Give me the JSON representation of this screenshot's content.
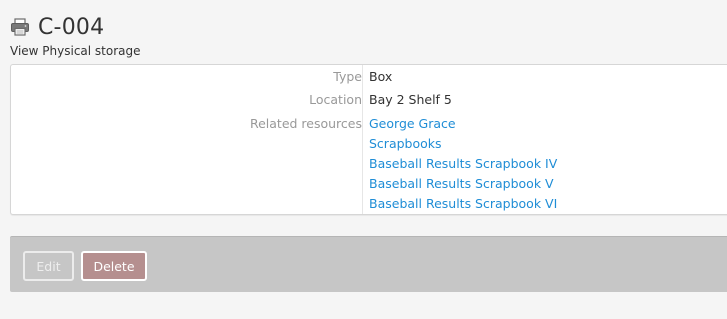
{
  "header": {
    "icon": "printer-icon",
    "title": "C-004",
    "subtitle": "View Physical storage"
  },
  "details": {
    "type_label": "Type",
    "type_value": "Box",
    "location_label": "Location",
    "location_value": "Bay 2 Shelf 5",
    "related_label": "Related resources",
    "related": [
      "George Grace",
      "Scrapbooks",
      "Baseball Results Scrapbook IV",
      "Baseball Results Scrapbook V",
      "Baseball Results Scrapbook VI"
    ]
  },
  "actions": {
    "edit_label": "Edit",
    "delete_label": "Delete"
  },
  "colors": {
    "link": "#1f8dd6",
    "label": "#999999",
    "action_bar": "#c6c6c6",
    "delete_button": "#b58f8f"
  }
}
